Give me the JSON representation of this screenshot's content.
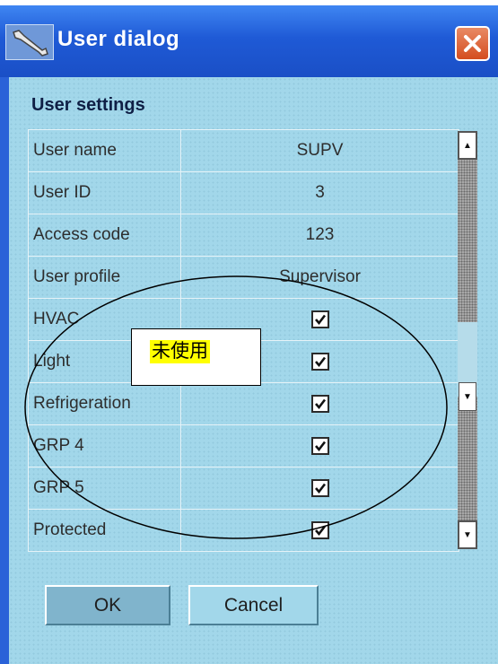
{
  "window": {
    "title": "User dialog"
  },
  "group": {
    "title": "User settings"
  },
  "rows": [
    {
      "label": "User name",
      "value": "SUPV"
    },
    {
      "label": "User ID",
      "value": "3"
    },
    {
      "label": "Access code",
      "value": "123"
    },
    {
      "label": "User profile",
      "value": "Supervisor"
    },
    {
      "label": "HVAC",
      "checked": true
    },
    {
      "label": "Light",
      "checked": true
    },
    {
      "label": "Refrigeration",
      "checked": true
    },
    {
      "label": "GRP 4",
      "checked": true
    },
    {
      "label": "GRP 5",
      "checked": true
    },
    {
      "label": "Protected",
      "checked": true
    }
  ],
  "buttons": {
    "ok": "OK",
    "cancel": "Cancel"
  },
  "annotation": {
    "text": "未使用"
  },
  "colors": {
    "titlebar": "#1f5ad6",
    "client": "#a2d7ea",
    "close": "#d44d1f",
    "annotation_highlight": "#ffff00"
  }
}
